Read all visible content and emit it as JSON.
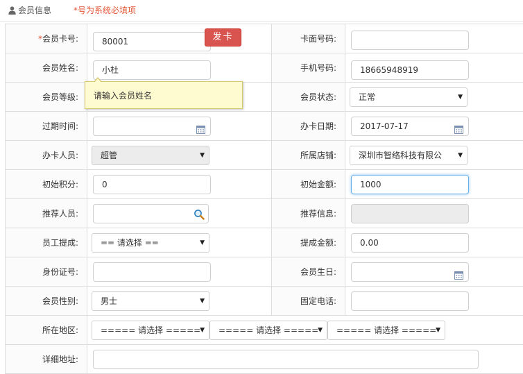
{
  "header": {
    "tab_label": "会员信息",
    "required_note": "*号为系统必填项"
  },
  "form": {
    "card_no": {
      "required_mark": "*",
      "label": "会员卡号:",
      "value": "80001",
      "button": "发卡"
    },
    "card_face_no": {
      "label": "卡面号码:",
      "value": ""
    },
    "member_name": {
      "label": "会员姓名:",
      "value": "小杜"
    },
    "mobile": {
      "label": "手机号码:",
      "value": "18665948919"
    },
    "member_level": {
      "label": "会员等级:"
    },
    "member_status": {
      "label": "会员状态:",
      "value": "正常"
    },
    "expire_time": {
      "label": "过期时间:",
      "value": ""
    },
    "issue_date": {
      "label": "办卡日期:",
      "value": "2017-07-17"
    },
    "issuer": {
      "label": "办卡人员:",
      "value": "超管"
    },
    "store": {
      "label": "所属店铺:",
      "value": "深圳市智络科技有限公"
    },
    "initial_points": {
      "label": "初始积分:",
      "value": "0"
    },
    "initial_amount": {
      "label": "初始金额:",
      "value": "1000"
    },
    "referrer": {
      "label": "推荐人员:",
      "value": ""
    },
    "referrer_info": {
      "label": "推荐信息:",
      "value": ""
    },
    "staff_commission": {
      "label": "员工提成:",
      "value": "== 请选择 =="
    },
    "commission_amount": {
      "label": "提成金额:",
      "value": "0.00"
    },
    "id_number": {
      "label": "身份证号:",
      "value": ""
    },
    "birthday": {
      "label": "会员生日:",
      "value": ""
    },
    "gender": {
      "label": "会员性别:",
      "value": "男士"
    },
    "landline": {
      "label": "固定电话:",
      "value": ""
    },
    "region": {
      "label": "所在地区:",
      "province": "===== 请选择 =====",
      "city": "===== 请选择 =====",
      "district": "===== 请选择 ====="
    },
    "address": {
      "label": "详细地址:",
      "value": ""
    }
  },
  "tooltip": {
    "text": "请输入会员姓名"
  },
  "icons": {
    "user": "user-icon",
    "calendar": "calendar-icon",
    "search": "search-icon",
    "dropdown": "chevron-down-icon"
  },
  "colors": {
    "required": "#e4593a",
    "button_red": "#d9534f",
    "focus_border": "#66afe9",
    "tooltip_bg": "#fffbd0"
  }
}
